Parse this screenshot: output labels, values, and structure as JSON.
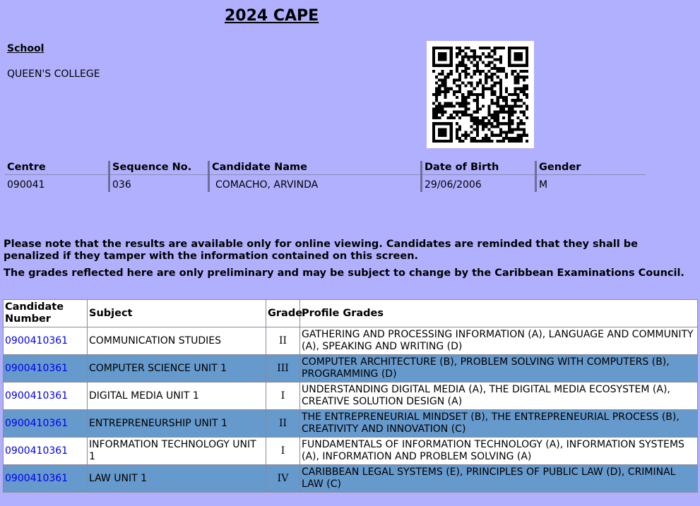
{
  "page_title": "2024 CAPE",
  "school": {
    "label": "School",
    "name": "QUEEN'S COLLEGE"
  },
  "candidate_info": {
    "centre": {
      "label": "Centre",
      "value": "090041"
    },
    "sequence": {
      "label": "Sequence No.",
      "value": "036"
    },
    "name": {
      "label": "Candidate Name",
      "value": "COMACHO, ARVINDA"
    },
    "dob": {
      "label": "Date of Birth",
      "value": "29/06/2006"
    },
    "gender": {
      "label": "Gender",
      "value": "M"
    }
  },
  "notices": {
    "line1": "Please note that the results are available only for online viewing. Candidates are reminded that they shall be penalized if they tamper with the information contained on this screen.",
    "line2": "The grades reflected here are only preliminary and may be subject to change by the Caribbean Examinations Council."
  },
  "results_table": {
    "headers": {
      "candidate_number": "Candidate Number",
      "subject": "Subject",
      "grade": "Grade",
      "profile_grades": "Profile Grades"
    },
    "rows": [
      {
        "candidate_number": "0900410361",
        "subject": "COMMUNICATION STUDIES",
        "grade": "II",
        "profile": "GATHERING AND PROCESSING INFORMATION (A), LANGUAGE AND COMMUNITY (A), SPEAKING AND WRITING (D)"
      },
      {
        "candidate_number": "0900410361",
        "subject": "COMPUTER SCIENCE UNIT 1",
        "grade": "III",
        "profile": "COMPUTER ARCHITECTURE (B), PROBLEM SOLVING WITH COMPUTERS (B), PROGRAMMING (D)"
      },
      {
        "candidate_number": "0900410361",
        "subject": "DIGITAL MEDIA UNIT 1",
        "grade": "I",
        "profile": "UNDERSTANDING DIGITAL MEDIA (A), THE DIGITAL MEDIA ECOSYSTEM (A), CREATIVE SOLUTION DESIGN (A)"
      },
      {
        "candidate_number": "0900410361",
        "subject": "ENTREPRENEURSHIP UNIT 1",
        "grade": "II",
        "profile": "THE ENTREPRENEURIAL MINDSET (B), THE ENTREPRENEURIAL PROCESS (B), CREATIVITY AND INNOVATION (C)"
      },
      {
        "candidate_number": "0900410361",
        "subject": "INFORMATION TECHNOLOGY UNIT 1",
        "grade": "I",
        "profile": "FUNDAMENTALS OF INFORMATION TECHNOLOGY (A), INFORMATION SYSTEMS (A), INFORMATION AND PROBLEM SOLVING (A)"
      },
      {
        "candidate_number": "0900410361",
        "subject": "LAW UNIT 1",
        "grade": "IV",
        "profile": "CARIBBEAN LEGAL SYSTEMS (E), PRINCIPLES OF PUBLIC LAW (D), CRIMINAL LAW (C)"
      }
    ]
  },
  "qr_code": {
    "icon": "qr-code-icon"
  },
  "colors": {
    "background": "#b0b0fe",
    "row_alt": "#6699cc",
    "link": "#0000ee"
  }
}
